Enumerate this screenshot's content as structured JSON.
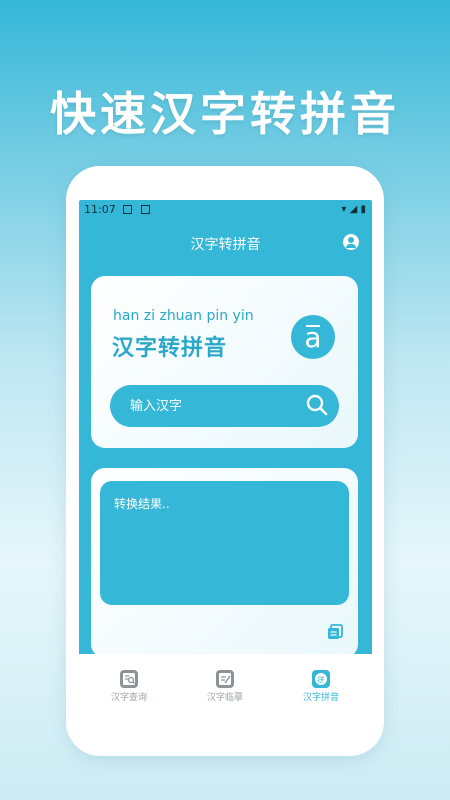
{
  "headline": "快速汉字转拼音",
  "status": {
    "time": "11:07"
  },
  "app": {
    "title": "汉字转拼音"
  },
  "hero": {
    "pinyin": "han zi zhuan pin yin",
    "hanzi": "汉字转拼音",
    "badge_letter": "a"
  },
  "search": {
    "placeholder": "输入汉字"
  },
  "result": {
    "placeholder": "转换结果.."
  },
  "nav": [
    {
      "label": "汉字查询",
      "icon": "search-book-icon",
      "active": false
    },
    {
      "label": "汉字临摹",
      "icon": "edit-note-icon",
      "active": false
    },
    {
      "label": "汉字拼音",
      "icon": "pinyin-icon",
      "active": true
    }
  ],
  "colors": {
    "accent": "#35b7d8",
    "inactive": "#9aa3a7"
  }
}
